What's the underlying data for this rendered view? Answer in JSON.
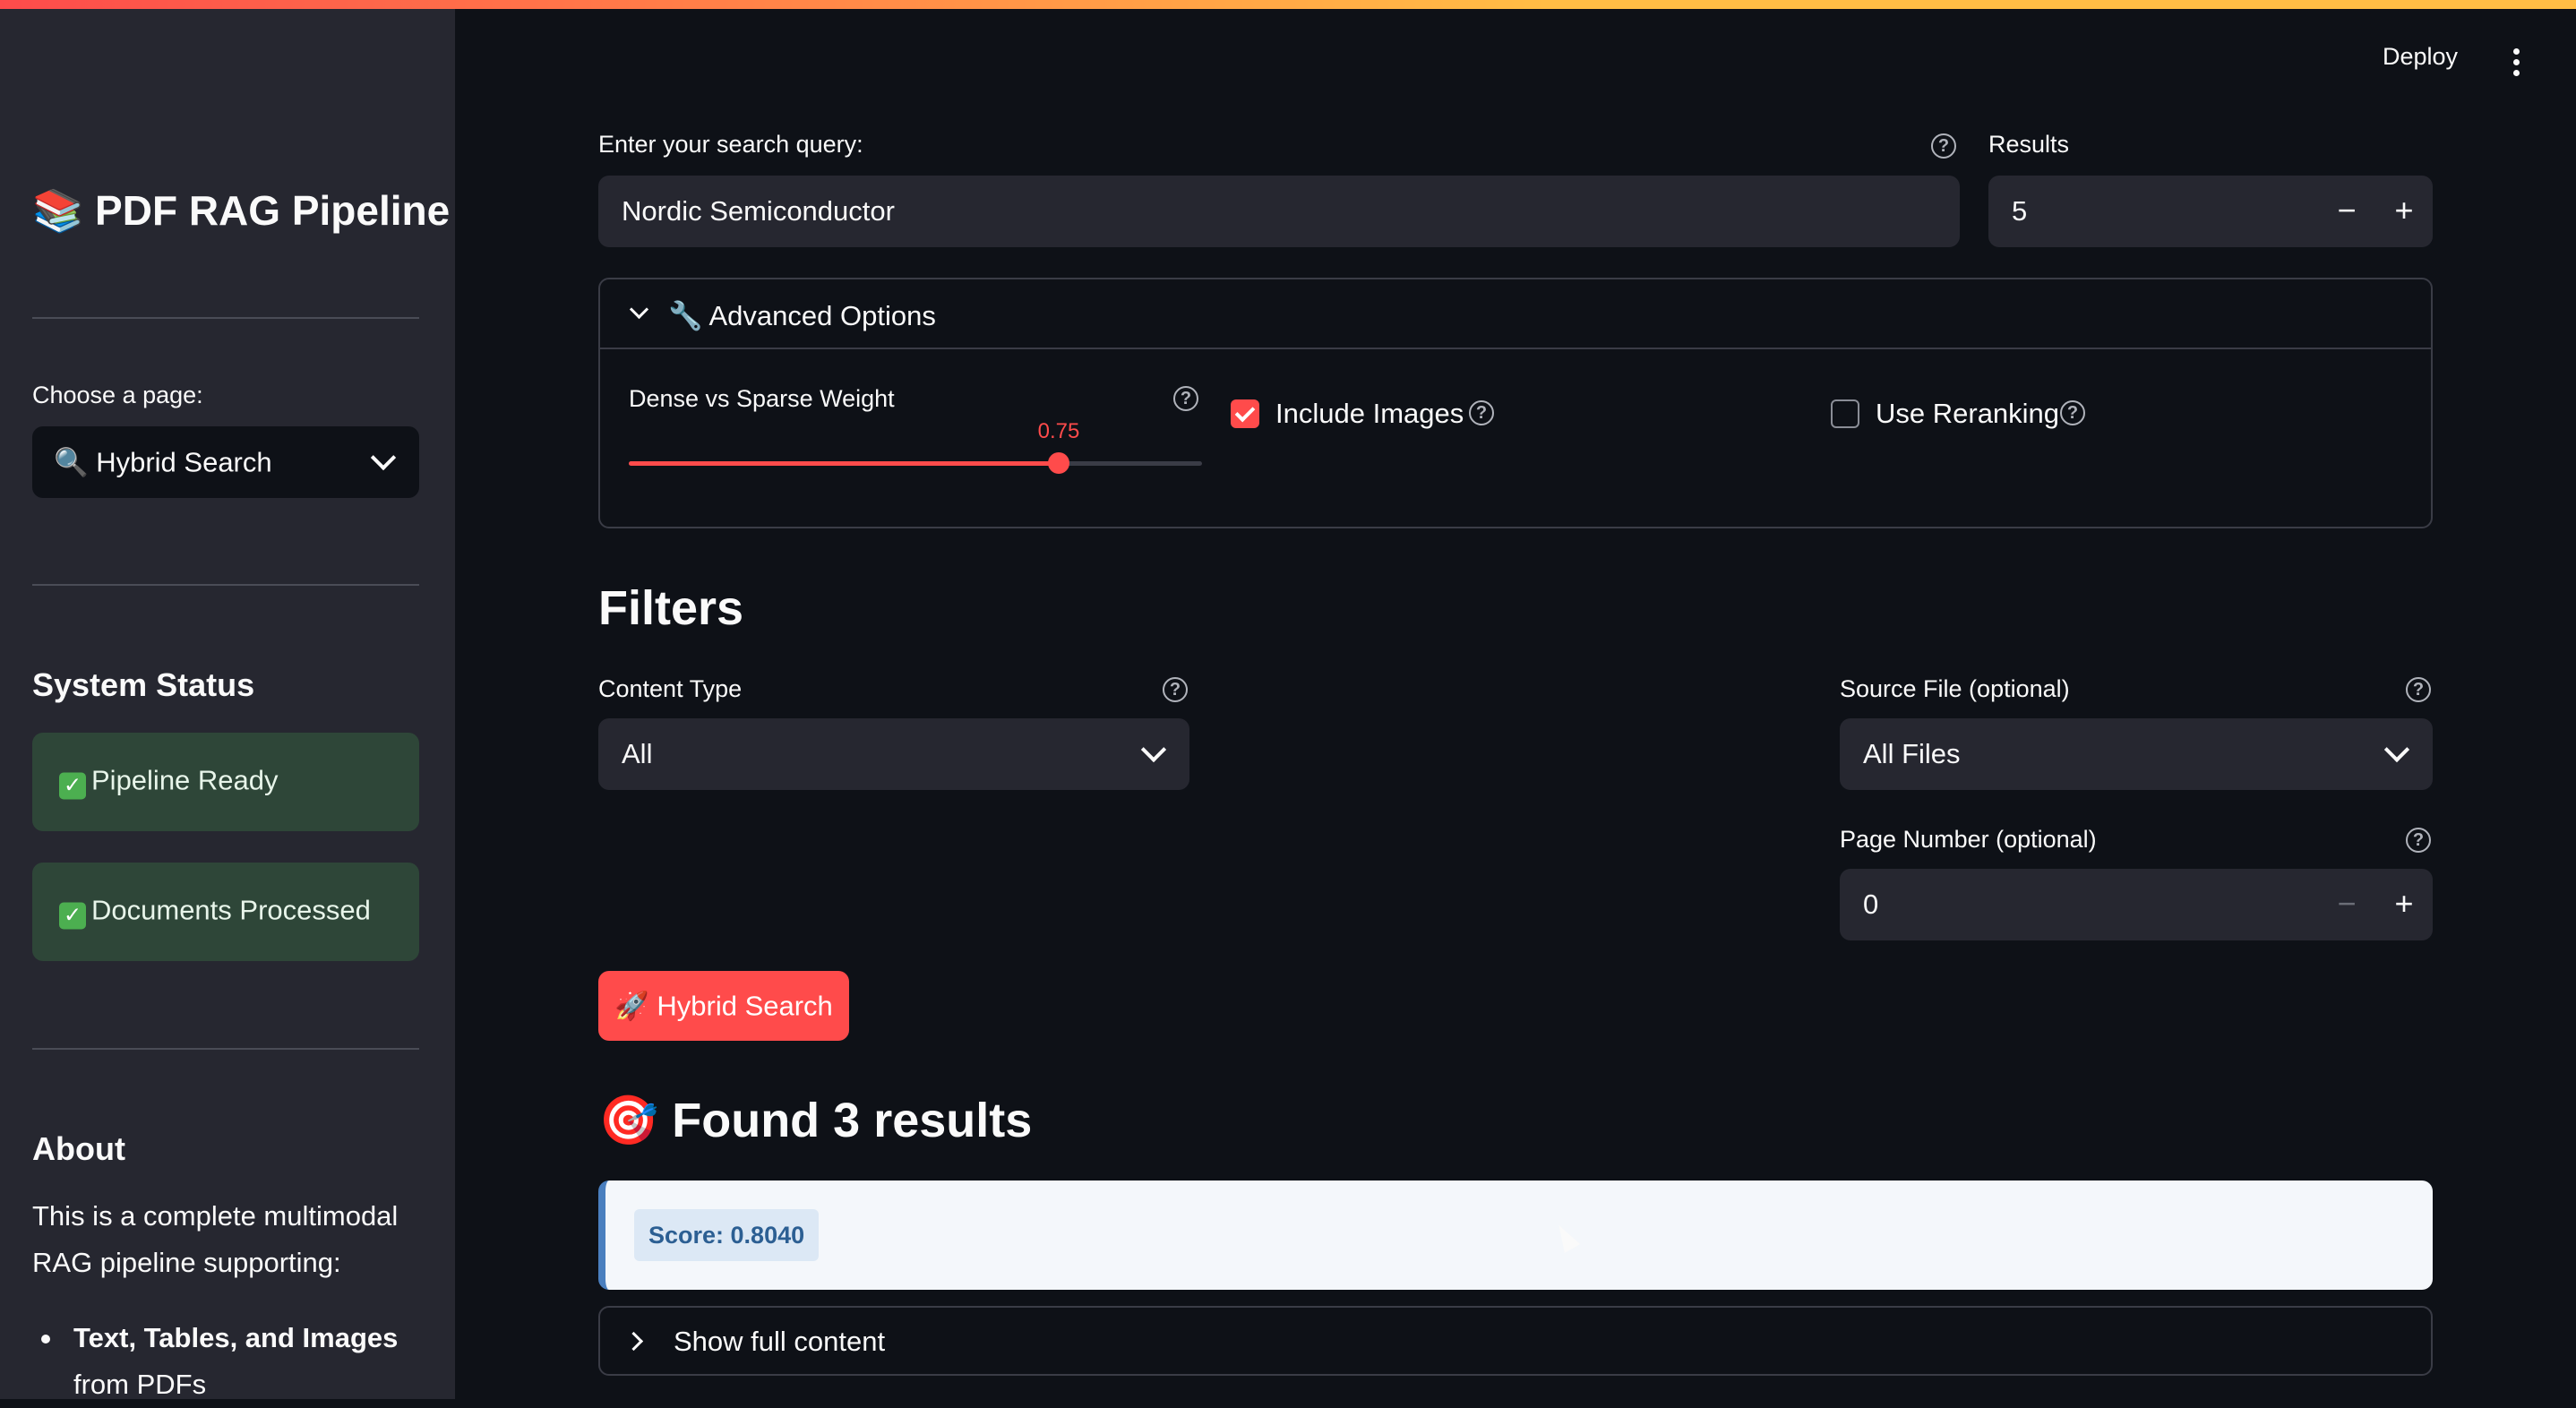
{
  "header": {
    "deploy_label": "Deploy",
    "menu_icon": "kebab-menu-icon"
  },
  "sidebar": {
    "title": "📚 PDF RAG Pipeline",
    "page_label": "Choose a page:",
    "page_selected": "🔍 Hybrid Search",
    "status_heading": "System Status",
    "status_items": [
      "Pipeline Ready",
      "Documents Processed"
    ],
    "about_heading": "About",
    "about_text": "This is a complete multimodal RAG pipeline supporting:",
    "about_bullets": [
      {
        "bold": "Text, Tables, and Images",
        "rest": " from PDFs"
      }
    ]
  },
  "search": {
    "query_label": "Enter your search query:",
    "query_value": "Nordic Semiconductor",
    "results_label": "Results",
    "results_value": "5",
    "minus": "−",
    "plus": "+"
  },
  "advanced": {
    "title": "🔧 Advanced Options",
    "weight_label": "Dense vs Sparse Weight",
    "weight_value": "0.75",
    "weight_fraction": 0.75,
    "include_images_label": "Include Images",
    "include_images_checked": true,
    "use_reranking_label": "Use Reranking",
    "use_reranking_checked": false
  },
  "filters": {
    "heading": "Filters",
    "content_type_label": "Content Type",
    "content_type_value": "All",
    "source_file_label": "Source File (optional)",
    "source_file_value": "All Files",
    "page_number_label": "Page Number (optional)",
    "page_number_value": "0"
  },
  "action": {
    "search_button": "🚀 Hybrid Search"
  },
  "results": {
    "heading": "🎯 Found 3 results",
    "first_score": "Score: 0.8040",
    "show_full_content": "Show full content"
  },
  "colors": {
    "accent": "#ff4b4b",
    "background": "#0e1117",
    "sidebar": "#262730",
    "success_bg": "#2e4638",
    "score_text": "#2c5f93"
  }
}
